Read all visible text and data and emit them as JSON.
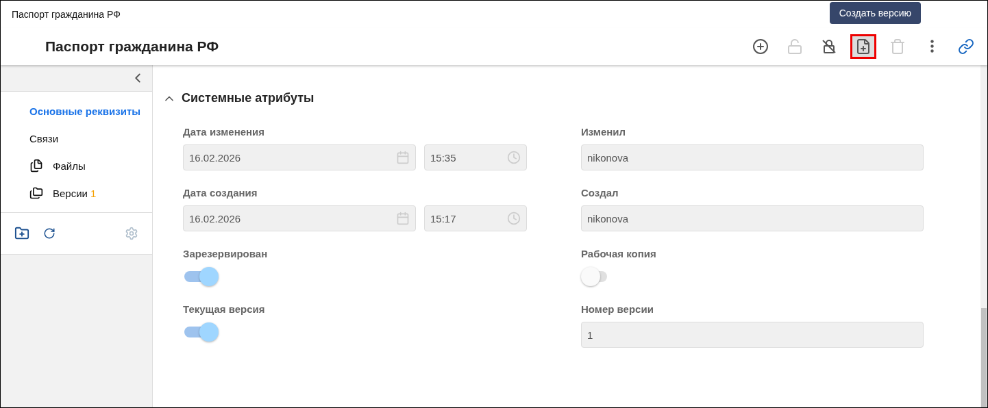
{
  "window": {
    "title": "Паспорт гражданина РФ"
  },
  "header": {
    "title": "Паспорт гражданина РФ"
  },
  "toolbar": [
    {
      "kind": "add",
      "disabled": false,
      "highlighted": false
    },
    {
      "kind": "unlock",
      "disabled": true,
      "highlighted": false
    },
    {
      "kind": "lock-off",
      "disabled": false,
      "highlighted": false
    },
    {
      "kind": "new-version",
      "disabled": false,
      "highlighted": true,
      "tooltip": "Создать версию"
    },
    {
      "kind": "delete",
      "disabled": true,
      "highlighted": false
    },
    {
      "kind": "more",
      "disabled": false,
      "highlighted": false
    },
    {
      "kind": "link",
      "disabled": false,
      "highlighted": false
    }
  ],
  "sidebar": {
    "items": [
      {
        "label": "Основные реквизиты",
        "selected": true
      },
      {
        "label": "Связи",
        "selected": false
      },
      {
        "label": "Файлы",
        "selected": false,
        "kind": "files"
      },
      {
        "label": "Версии",
        "selected": false,
        "kind": "folders",
        "badge": "1"
      }
    ]
  },
  "section": {
    "title": "Системные атрибуты",
    "expanded": true,
    "fields": [
      {
        "kind": "datetime",
        "label": "Дата изменения",
        "date": "16.02.2026",
        "time": "15:35"
      },
      {
        "kind": "text",
        "label": "Изменил",
        "value": "nikonova"
      },
      {
        "kind": "datetime",
        "label": "Дата создания",
        "date": "16.02.2026",
        "time": "15:17"
      },
      {
        "kind": "text",
        "label": "Создал",
        "value": "nikonova"
      },
      {
        "kind": "toggle",
        "label": "Зарезервирован",
        "on": true
      },
      {
        "kind": "toggle",
        "label": "Рабочая копия",
        "on": false
      },
      {
        "kind": "toggle",
        "label": "Текущая версия",
        "on": true
      },
      {
        "kind": "text",
        "label": "Номер версии",
        "value": "1"
      }
    ]
  }
}
